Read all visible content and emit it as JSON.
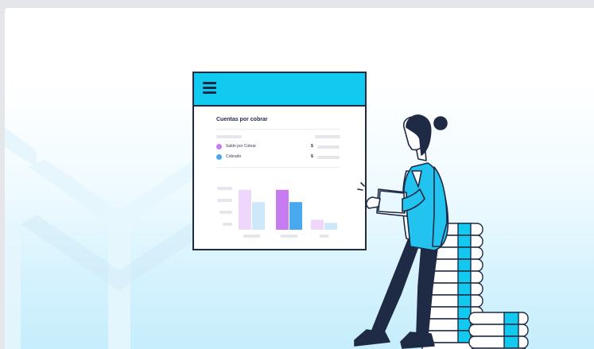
{
  "window": {
    "title": "Cuentas por cobrar"
  },
  "legend": [
    {
      "label": "Saldo por Cobrar",
      "currency": "$",
      "color": "#c67cf0"
    },
    {
      "label": "Cobrado",
      "currency": "$",
      "color": "#4aa8ef"
    }
  ],
  "colors": {
    "accent": "#12c9ef",
    "outline": "#1f2a44",
    "purple": "#c67cf0",
    "blue": "#4aa8ef",
    "light_purple": "#efd7fb",
    "light_blue": "#cde7fb"
  },
  "chart_data": {
    "type": "bar",
    "categories": [
      "",
      "",
      ""
    ],
    "series": [
      {
        "values": [
          5.2,
          5.2,
          1.3
        ]
      },
      {
        "values": [
          3.6,
          3.6,
          0.9
        ]
      }
    ],
    "ylim": [
      0,
      6
    ],
    "grid": false
  }
}
